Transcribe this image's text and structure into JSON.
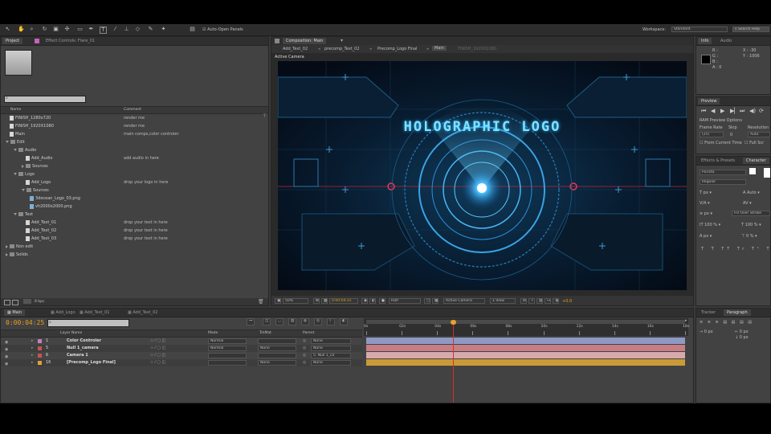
{
  "toolbar": {
    "auto_open_panels": "Auto-Open Panels",
    "workspace_label": "Workspace:",
    "workspace_value": "Standard",
    "search_help": "Search Help"
  },
  "project": {
    "tabs": [
      "Project",
      "Effect Controls: Flare_01"
    ],
    "columns": {
      "name": "Name",
      "comment": "Comment"
    },
    "items": [
      {
        "name": "FINISH_1280x720",
        "comment": "render me",
        "type": "comp",
        "indent": 0
      },
      {
        "name": "FINISH_1920X1080",
        "comment": "render me",
        "type": "comp",
        "indent": 0
      },
      {
        "name": "Main",
        "comment": "main comps,color controler",
        "type": "comp",
        "indent": 0
      },
      {
        "name": "Edit",
        "comment": "",
        "type": "folder-open",
        "indent": 0
      },
      {
        "name": "Audio",
        "comment": "",
        "type": "folder-open",
        "indent": 1
      },
      {
        "name": "Add_Audio",
        "comment": "add audio in here",
        "type": "comp",
        "indent": 2
      },
      {
        "name": "Sources",
        "comment": "",
        "type": "folder",
        "indent": 2
      },
      {
        "name": "Logo",
        "comment": "",
        "type": "folder-open",
        "indent": 1
      },
      {
        "name": "Add_Logo",
        "comment": "drop your logo in here",
        "type": "comp",
        "indent": 2
      },
      {
        "name": "Sources",
        "comment": "",
        "type": "folder-open",
        "indent": 2
      },
      {
        "name": "3docean_Logo_03.png",
        "comment": "",
        "type": "image",
        "indent": 3
      },
      {
        "name": "vh2000x2000.png",
        "comment": "",
        "type": "image",
        "indent": 3
      },
      {
        "name": "Text",
        "comment": "",
        "type": "folder-open",
        "indent": 1
      },
      {
        "name": "Add_Text_01",
        "comment": "drop your text in here",
        "type": "comp",
        "indent": 2
      },
      {
        "name": "Add_Text_02",
        "comment": "drop your text in here",
        "type": "comp",
        "indent": 2
      },
      {
        "name": "Add_Text_03",
        "comment": "drop your text in here",
        "type": "comp",
        "indent": 2
      },
      {
        "name": "Non edit",
        "comment": "",
        "type": "folder",
        "indent": 0
      },
      {
        "name": "Solids",
        "comment": "",
        "type": "folder",
        "indent": 0
      }
    ],
    "bpc": "8 bpc"
  },
  "composition": {
    "tab_title": "Composition: Main",
    "breadcrumbs": [
      "Add_Text_02",
      "precomp_Text_02",
      "Precomp_Logo Final",
      "Main",
      "FINISH_1920X1080"
    ],
    "view_label": "Active Camera",
    "logo_text": "HOLOGRAPHIC LOGO",
    "zoom": "50%",
    "timecode": "0:00:04:25",
    "resolution": "Half",
    "camera": "Active Camera",
    "views": "1 View",
    "exposure": "+0.0"
  },
  "info": {
    "tabs": [
      "Info",
      "Audio"
    ],
    "r": "R :",
    "g": "G :",
    "b": "B :",
    "a": "A : 0",
    "x": "X : -30",
    "y": "Y : 1006"
  },
  "preview": {
    "title": "Preview",
    "ram_options": "RAM Preview Options",
    "frame_rate_label": "Frame Rate",
    "skip_label": "Skip",
    "resolution_label": "Resolution",
    "frame_rate_value": "(25)",
    "skip_value": "0",
    "resolution_value": "Auto",
    "from_current": "From Current Time",
    "full_screen": "Full Scr"
  },
  "character": {
    "tabs": [
      "Effects & Presets",
      "Character"
    ],
    "font": "Purista",
    "style": "Regular",
    "size_unit": "px",
    "fill_label": "Fill Over Stroke",
    "pct1": "100 %",
    "pct2": "100 %",
    "px_a": "px",
    "px_b": "px"
  },
  "paragraph": {
    "tabs": [
      "Tracker",
      "Paragraph"
    ],
    "v1": "0 px",
    "v2": "0 px",
    "v3": "0 px"
  },
  "timeline": {
    "tabs": [
      "Main",
      "Add_Logo",
      "Add_Text_01",
      "Add_Text_02"
    ],
    "timecode": "0:00:04:25",
    "columns": {
      "layer_name": "Layer Name",
      "mode": "Mode",
      "trkmat": "TrkMat",
      "parent": "Parent"
    },
    "ruler": [
      "0s",
      "02s",
      "04s",
      "06s",
      "08s",
      "10s",
      "12s",
      "14s",
      "16s",
      "18s"
    ],
    "layers": [
      {
        "num": "1",
        "name": "Color Controler",
        "mode": "Normal",
        "trkmat": "",
        "parent": "None",
        "color": "#8e9ac4",
        "label": "#c87fbf"
      },
      {
        "num": "5",
        "name": "Null 1_camera",
        "mode": "Normal",
        "trkmat": "None",
        "parent": "None",
        "color": "#c77d84",
        "label": "#c45454"
      },
      {
        "num": "6",
        "name": "Camera 1",
        "mode": "",
        "trkmat": "",
        "parent": "5. Null 1_ca",
        "color": "#d6a9ad",
        "label": "#c45454"
      },
      {
        "num": "16",
        "name": "[Precomp_Logo Final]",
        "mode": "",
        "trkmat": "None",
        "parent": "None",
        "color": "#c99a38",
        "label": "#e0a03a"
      }
    ],
    "playhead_seconds": 4.9
  },
  "colors": {
    "accent_orange": "#e8a22a",
    "timecode_orange": "#e7a11d",
    "playhead_red": "#d22f2f"
  }
}
